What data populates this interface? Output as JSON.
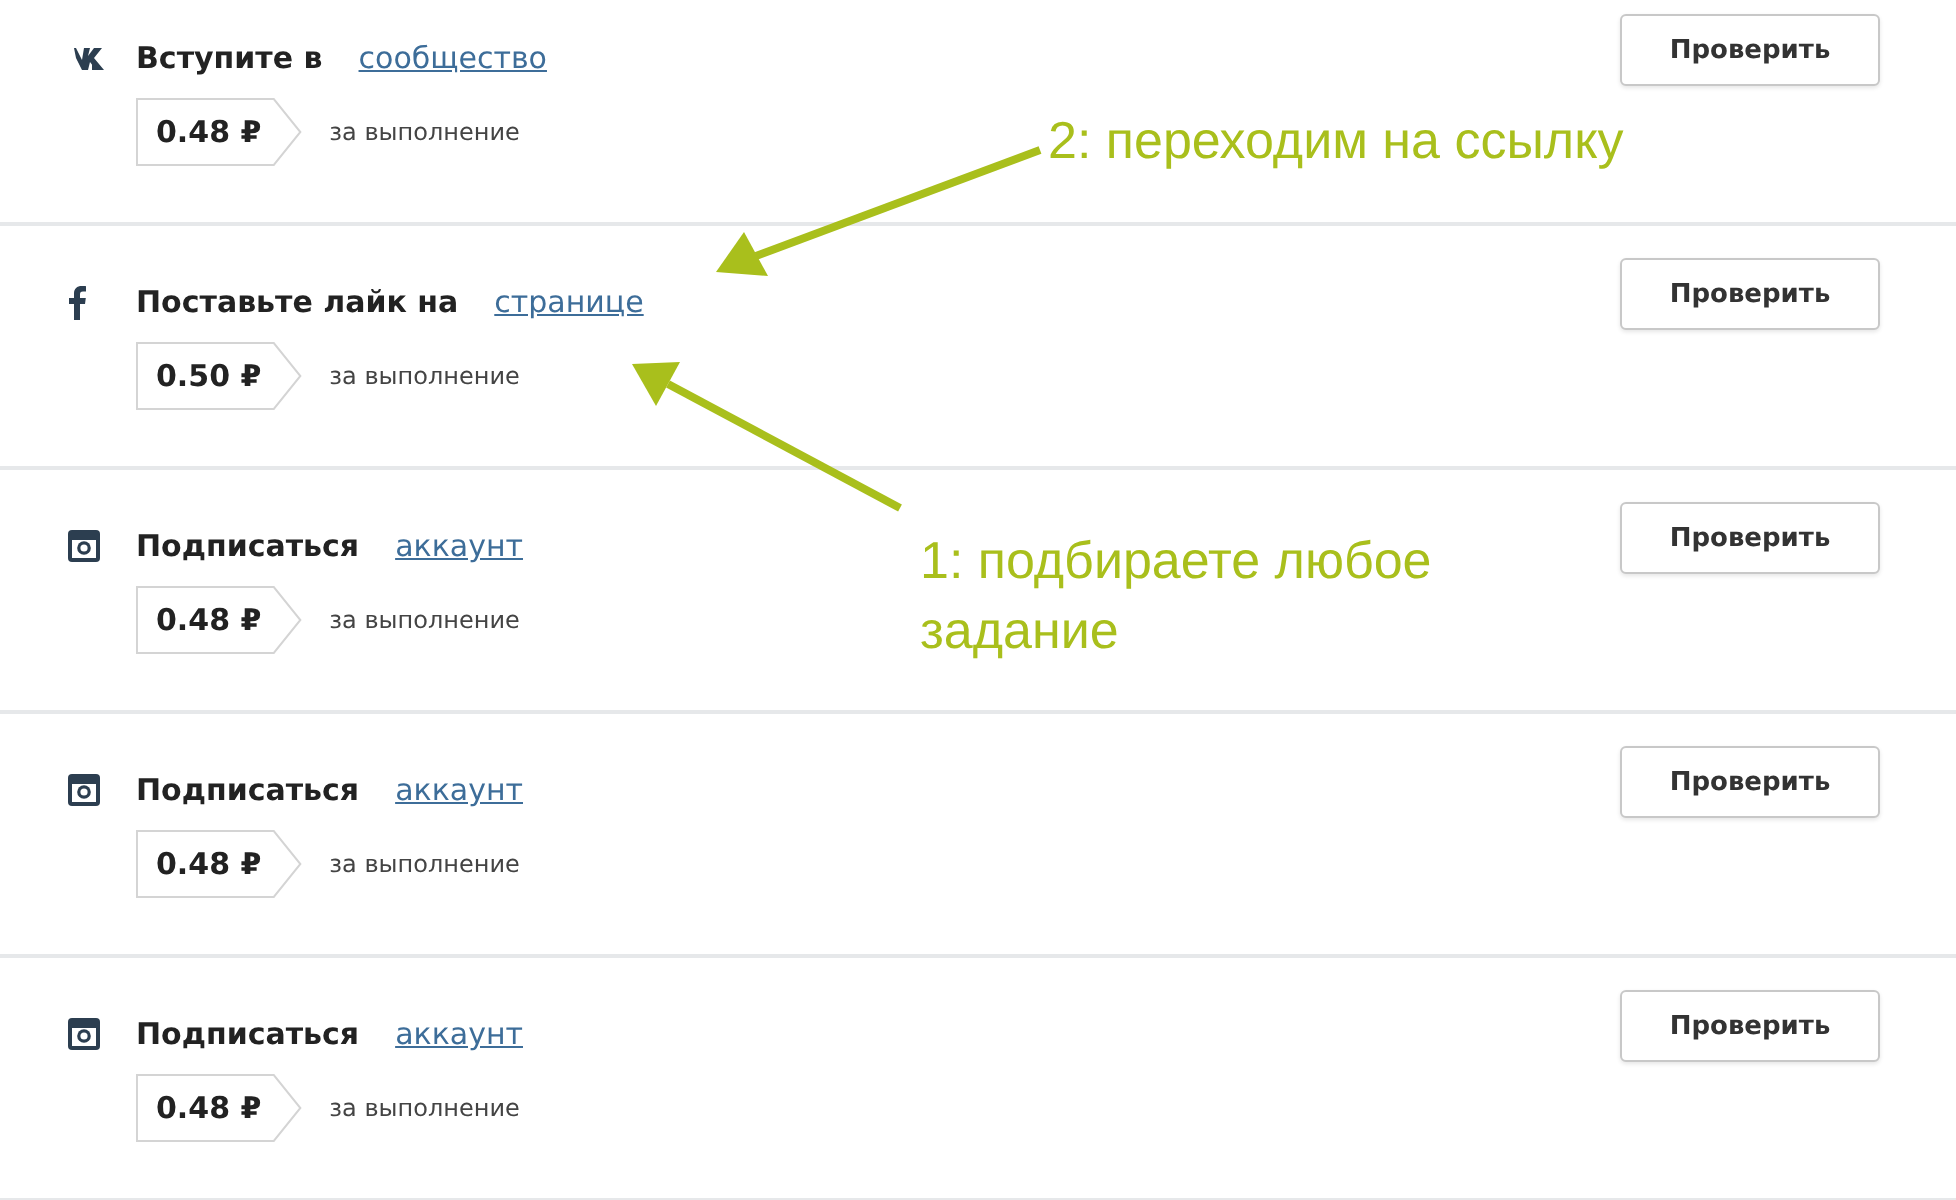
{
  "tasks": [
    {
      "kind": "vk",
      "title": "Вступите в",
      "link": "сообщество",
      "price": "0.48 ₽",
      "note": "за выполнение",
      "button": "Проверить"
    },
    {
      "kind": "facebook",
      "title": "Поставьте лайк на",
      "link": "странице",
      "price": "0.50 ₽",
      "note": "за выполнение",
      "button": "Проверить"
    },
    {
      "kind": "instagram",
      "title": "Подписаться",
      "link": "аккаунт",
      "price": "0.48 ₽",
      "note": "за выполнение",
      "button": "Проверить"
    },
    {
      "kind": "instagram",
      "title": "Подписаться",
      "link": "аккаунт",
      "price": "0.48 ₽",
      "note": "за выполнение",
      "button": "Проверить"
    },
    {
      "kind": "instagram",
      "title": "Подписаться",
      "link": "аккаунт",
      "price": "0.48 ₽",
      "note": "за выполнение",
      "button": "Проверить"
    }
  ],
  "annotations": [
    {
      "text": "2: переходим на ссылку"
    },
    {
      "text": "1: подбираете любое задание"
    }
  ]
}
